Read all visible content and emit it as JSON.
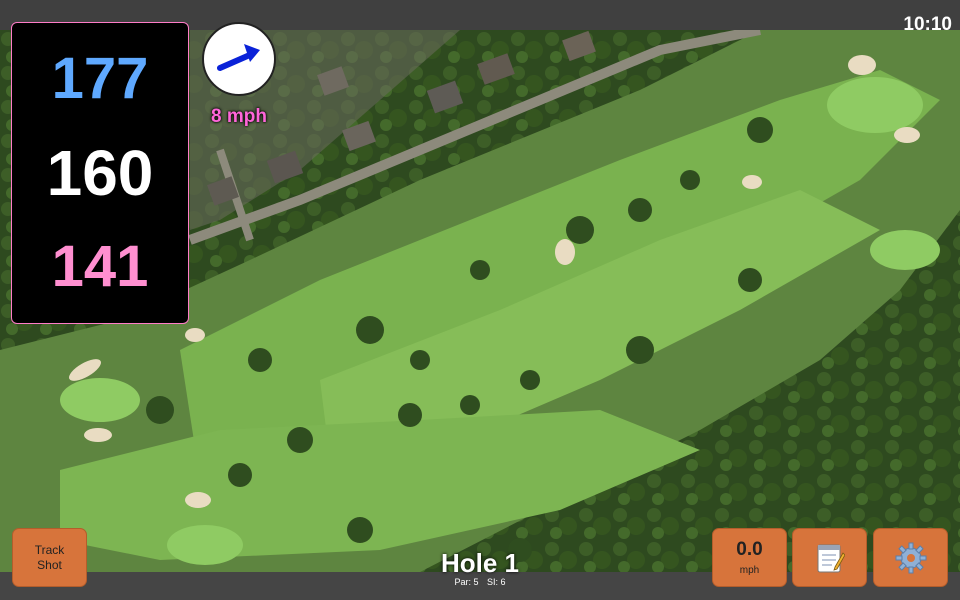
{
  "status": {
    "time": "10:10"
  },
  "yardage": {
    "back": "177",
    "middle": "160",
    "front": "141"
  },
  "wind": {
    "speed_label": "8 mph",
    "direction_icon": "arrow-up-right-icon"
  },
  "hole": {
    "title": "Hole 1",
    "par_label": "Par: 5",
    "si_label": "SI: 6"
  },
  "buttons": {
    "track_shot_line1": "Track",
    "track_shot_line2": "Shot",
    "speed_value": "0.0",
    "speed_unit": "mph",
    "notes_icon": "notepad-icon",
    "settings_icon": "gear-icon"
  },
  "colors": {
    "back_yardage": "#5fa9ff",
    "middle_yardage": "#ffffff",
    "front_yardage": "#ff8fd0",
    "button": "#d7743b",
    "wind_text": "#ff66d9",
    "fairway": "#6fa445"
  }
}
